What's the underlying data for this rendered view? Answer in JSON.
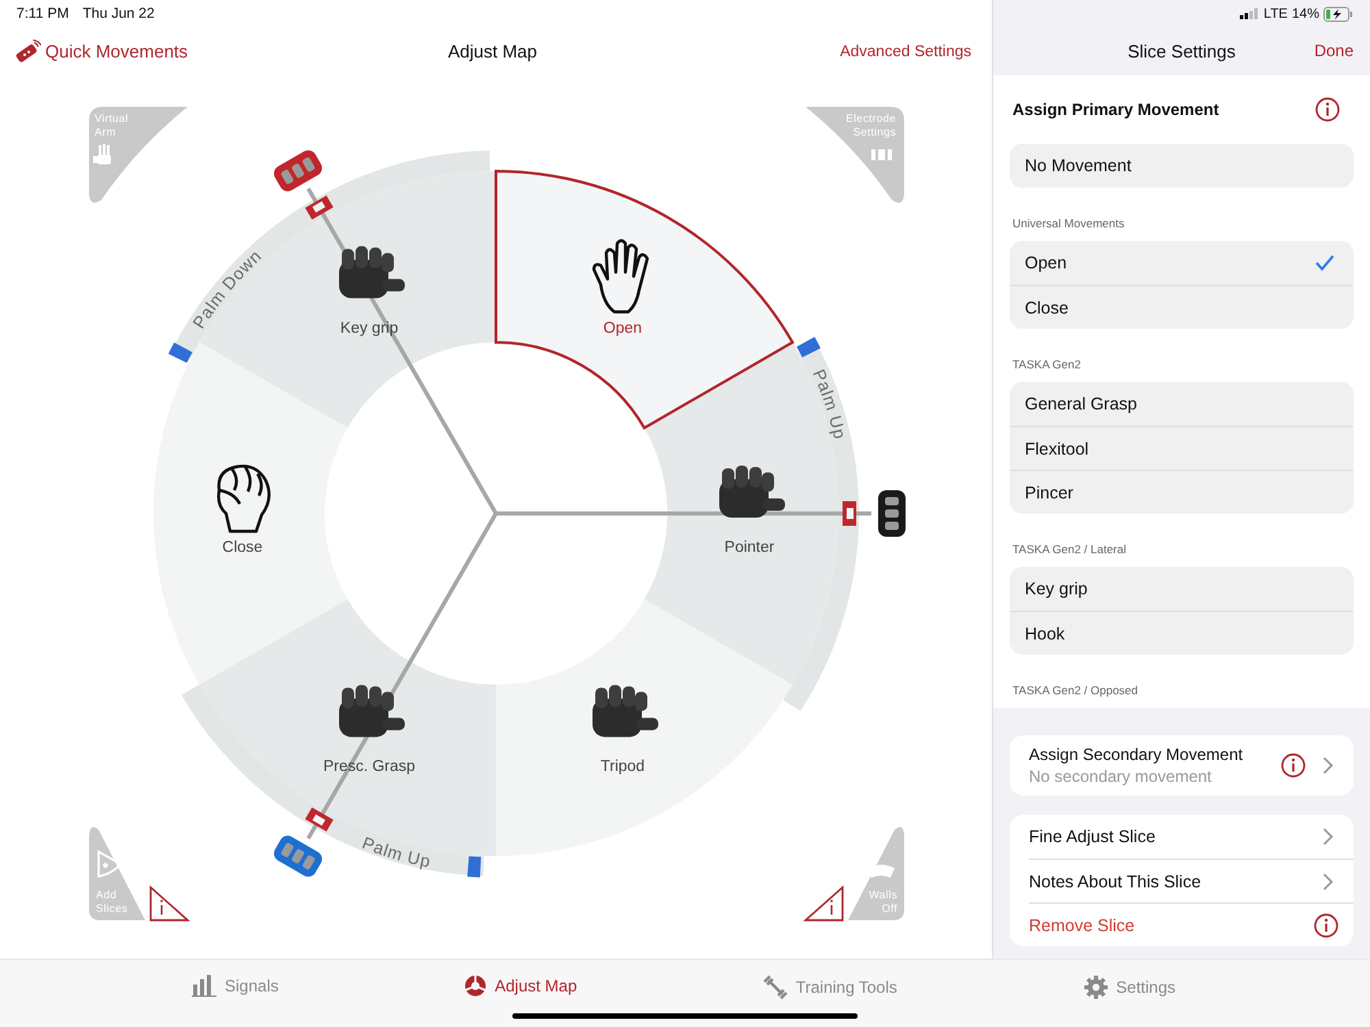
{
  "status_bar": {
    "time": "7:11 PM",
    "date": "Thu Jun 22",
    "network": "LTE",
    "battery": "14%"
  },
  "nav": {
    "quick": "Quick Movements",
    "title": "Adjust Map",
    "advanced": "Advanced Settings"
  },
  "corners": [
    {
      "label": "Virtual Arm",
      "kind": "arm"
    },
    {
      "label": "Electrode Settings",
      "kind": "electrodes"
    },
    {
      "label": "Add Slices",
      "kind": "add"
    },
    {
      "label": "Walls Off",
      "kind": "walls"
    }
  ],
  "slices": [
    {
      "label": "Key grip",
      "kind": "robot",
      "selected": false
    },
    {
      "label": "Open",
      "kind": "openhand",
      "selected": true
    },
    {
      "label": "Pointer",
      "kind": "robot",
      "selected": false
    },
    {
      "label": "Tripod",
      "kind": "robot",
      "selected": false
    },
    {
      "label": "Presc. Grasp",
      "kind": "robot",
      "selected": false
    },
    {
      "label": "Close",
      "kind": "fist",
      "selected": false
    }
  ],
  "bands": [
    {
      "label": "Palm Down"
    },
    {
      "label": "Palm Up"
    },
    {
      "label": "Palm Up"
    }
  ],
  "dividers": [
    {
      "color": "#c0272d"
    },
    {
      "color": "#1a1a1a"
    },
    {
      "color": "#1f6fd1"
    }
  ],
  "panel": {
    "title": "Slice Settings",
    "done": "Done",
    "primary_title": "Assign Primary Movement",
    "groups": [
      {
        "items": [
          {
            "label": "No Movement",
            "selected": false
          }
        ]
      },
      {
        "header": "Universal Movements",
        "items": [
          {
            "label": "Open",
            "selected": true
          },
          {
            "label": "Close",
            "selected": false
          }
        ]
      },
      {
        "header": "TASKA Gen2",
        "items": [
          {
            "label": "General Grasp",
            "selected": false
          },
          {
            "label": "Flexitool",
            "selected": false
          },
          {
            "label": "Pincer",
            "selected": false
          }
        ]
      },
      {
        "header": "TASKA Gen2 / Lateral",
        "items": [
          {
            "label": "Key grip",
            "selected": false
          },
          {
            "label": "Hook",
            "selected": false
          }
        ]
      },
      {
        "header": "TASKA Gen2 / Opposed"
      }
    ],
    "secondary": {
      "title": "Assign Secondary Movement",
      "value": "No secondary movement"
    },
    "actions": [
      {
        "label": "Fine Adjust Slice",
        "kind": "nav"
      },
      {
        "label": "Notes About This Slice",
        "kind": "nav"
      },
      {
        "label": "Remove Slice",
        "kind": "danger"
      }
    ]
  },
  "tabs": [
    {
      "label": "Signals",
      "kind": "signals",
      "selected": false
    },
    {
      "label": "Adjust Map",
      "kind": "map",
      "selected": true
    },
    {
      "label": "Training Tools",
      "kind": "training",
      "selected": false
    },
    {
      "label": "Settings",
      "kind": "settings",
      "selected": false
    }
  ]
}
